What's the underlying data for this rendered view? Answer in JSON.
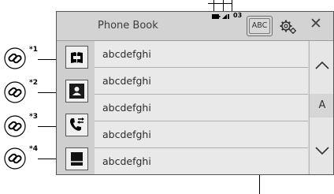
{
  "header": {
    "title": "Phone Book",
    "status_number": "03",
    "index_button_label": "ABC"
  },
  "side_buttons": [
    "contacts-book-icon",
    "person-icon",
    "call-history-icon",
    "keypad-icon"
  ],
  "contacts": [
    {
      "name": "abcdefghi"
    },
    {
      "name": "abcdefghi"
    },
    {
      "name": "abcdefghi"
    },
    {
      "name": "abcdefghi"
    },
    {
      "name": "abcdefghi"
    }
  ],
  "scroll": {
    "index_letter": "A"
  },
  "callouts": [
    {
      "ref": "*1"
    },
    {
      "ref": "*2"
    },
    {
      "ref": "*3"
    },
    {
      "ref": "*4"
    }
  ],
  "colors": {
    "screen_bg": "#dcdcdc",
    "row_bg": "#e9e9e9",
    "text": "#2a2a2a"
  }
}
